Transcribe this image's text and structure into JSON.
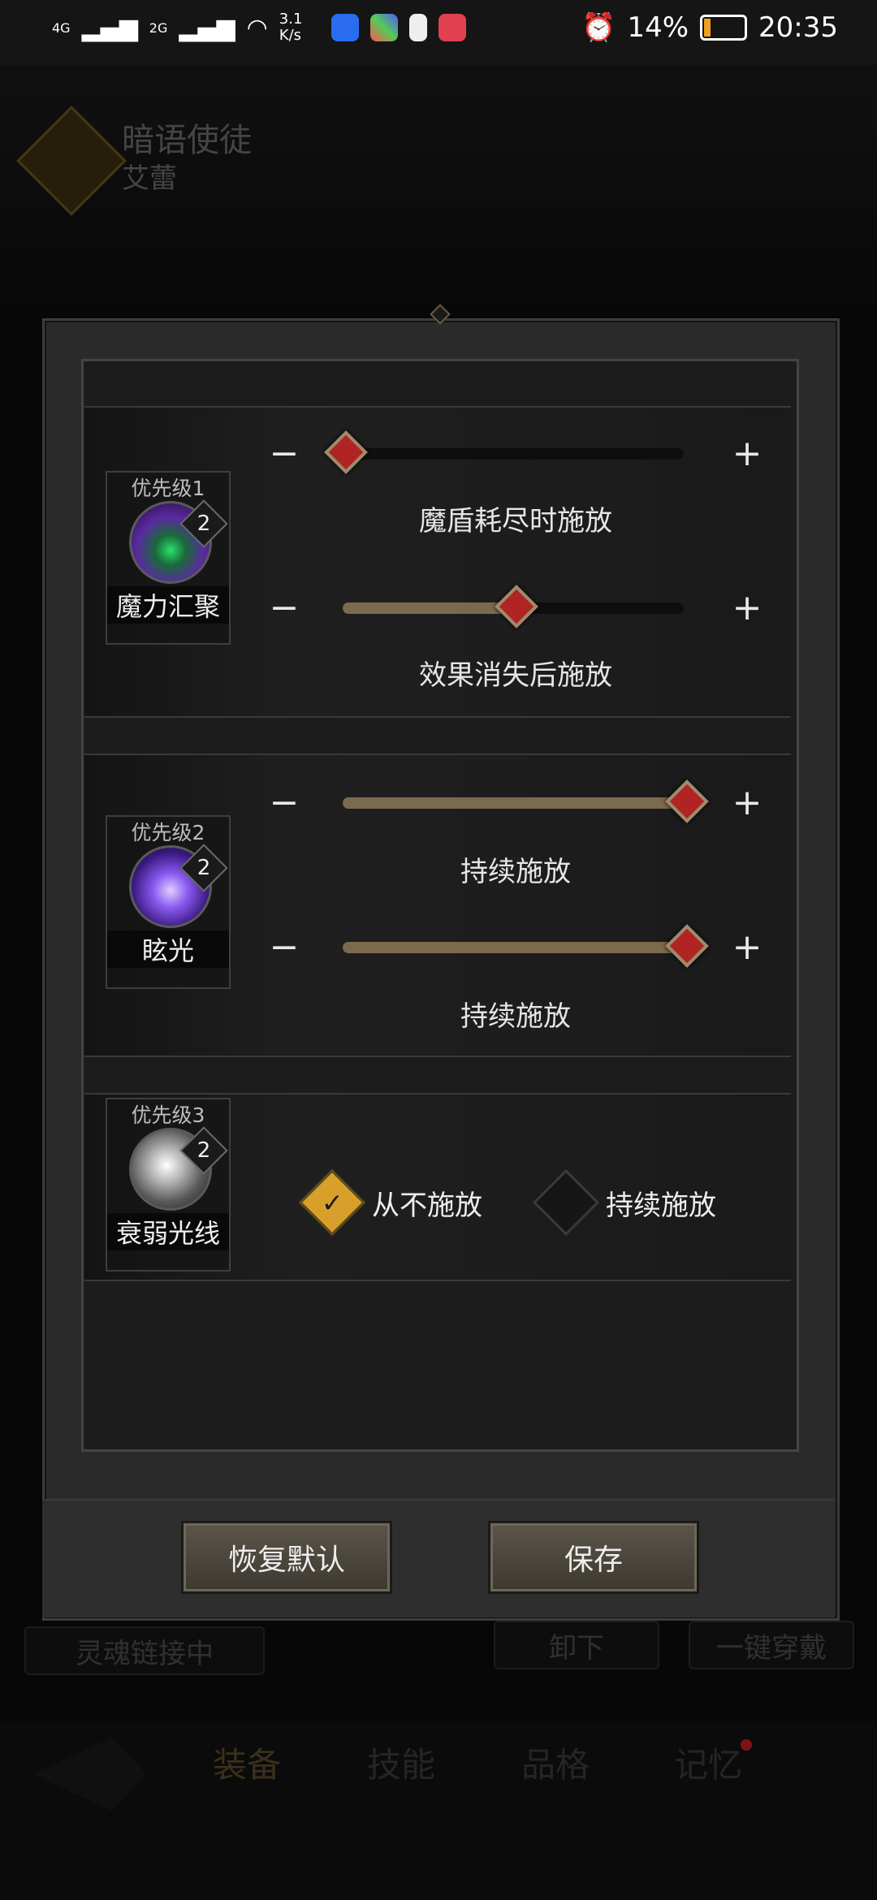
{
  "status_bar": {
    "net1": "4G",
    "net2": "2G",
    "speed": "3.1 K/s",
    "battery": "14%",
    "time": "20:35",
    "icons": [
      "signal-icon",
      "wifi-icon",
      "app-icon-blue",
      "app-icon-colorful",
      "app-icon-battery",
      "app-icon-red",
      "alarm-icon",
      "battery-icon"
    ]
  },
  "background": {
    "class_name": "暗语使徒",
    "character_name": "艾蕾",
    "soul_link": "灵魂链接中",
    "unequip": "卸下",
    "equip_all": "一键穿戴",
    "tabs": [
      "装备",
      "技能",
      "品格",
      "记忆"
    ]
  },
  "dialog": {
    "skills": [
      {
        "priority": "优先级1",
        "name": "魔力汇聚",
        "level": "2",
        "icon": "magic-gather-icon",
        "sliders": [
          {
            "label": "魔盾耗尽时施放",
            "value": 0.0
          },
          {
            "label": "效果消失后施放",
            "value": 0.5
          }
        ]
      },
      {
        "priority": "优先级2",
        "name": "眩光",
        "level": "2",
        "icon": "glare-icon",
        "sliders": [
          {
            "label": "持续施放",
            "value": 1.0
          },
          {
            "label": "持续施放",
            "value": 1.0
          }
        ]
      },
      {
        "priority": "优先级3",
        "name": "衰弱光线",
        "level": "2",
        "icon": "weakening-ray-icon",
        "options": [
          {
            "label": "从不施放",
            "selected": true
          },
          {
            "label": "持续施放",
            "selected": false
          }
        ]
      }
    ],
    "reset_label": "恢复默认",
    "save_label": "保存"
  },
  "colors": {
    "accent_gold": "#d8a02a",
    "slider_fill": "#7b6a4d",
    "thumb_red": "#b02424"
  }
}
